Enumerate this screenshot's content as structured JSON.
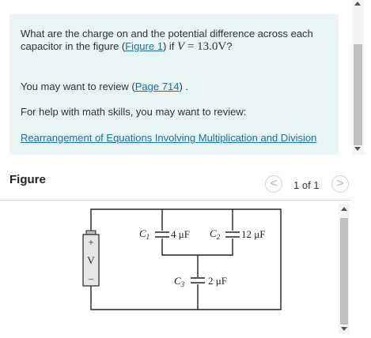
{
  "question": {
    "prefix": "What are the charge on and the potential difference across each capacitor in the figure (",
    "figure_link": "Figure 1",
    "middle": ") if ",
    "variable": "V",
    "equals": " = 13.0V",
    "suffix": "?"
  },
  "review": {
    "prefix": "You may want to review (",
    "link": "Page 714",
    "suffix": ") ."
  },
  "help": {
    "text": "For help with math skills, you may want to review:",
    "link": "Rearrangement of Equations Involving Multiplication and Division"
  },
  "figure": {
    "title": "Figure",
    "pager": "1 of 1",
    "prev_icon": "<",
    "next_icon": ">"
  },
  "circuit": {
    "battery_plus": "+",
    "battery_label": "V",
    "battery_minus": "–",
    "c1_name": "C",
    "c1_sub": "1",
    "c1_value": "4 μF",
    "c2_name": "C",
    "c2_sub": "2",
    "c2_value": "12 μF",
    "c3_name": "C",
    "c3_sub": "3",
    "c3_value": "2 μF"
  },
  "colors": {
    "panel_bg": "#e8f4f6",
    "link": "#1a6fa0",
    "battery_fill": "#e6e6e6"
  }
}
